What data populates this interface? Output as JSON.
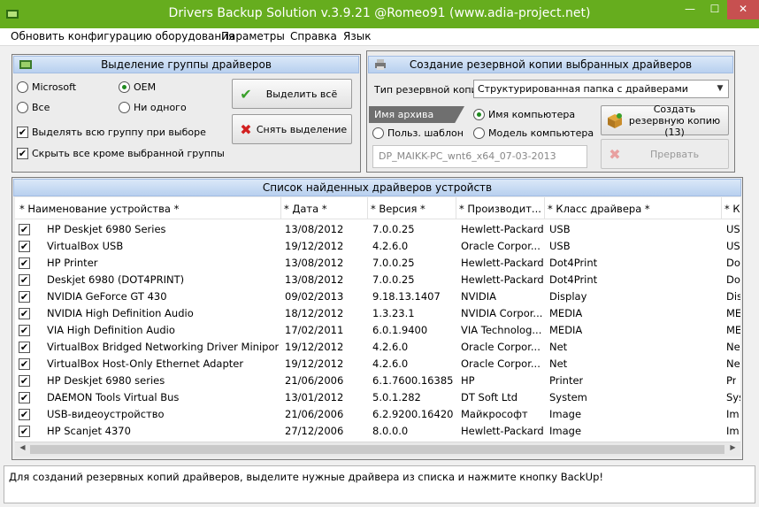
{
  "window": {
    "title": "Drivers Backup Solution v.3.9.21 @Romeo91 (www.adia-project.net)",
    "minimize": "—",
    "maximize": "☐",
    "close": "✕"
  },
  "menu": [
    "Обновить конфигурацию оборудования",
    "Параметры",
    "Справка",
    "Язык"
  ],
  "selection_panel": {
    "title": "Выделение группы драйверов",
    "radios": [
      {
        "label": "Microsoft",
        "checked": false
      },
      {
        "label": "OEM",
        "checked": true
      },
      {
        "label": "Все",
        "checked": false
      },
      {
        "label": "Ни одного",
        "checked": false
      }
    ],
    "checkboxes": [
      {
        "label": "Выделять всю группу при выборе",
        "checked": true
      },
      {
        "label": "Скрыть все кроме выбранной группы",
        "checked": true
      }
    ],
    "select_all_label": "Выделить всё",
    "deselect_label": "Снять выделение"
  },
  "backup_panel": {
    "title": "Создание резервной копии выбранных драйверов",
    "backup_type_label": "Тип резервной копии",
    "backup_type_value": "Структурированная папка с драйверами",
    "archive_name_tab": "Имя архива",
    "radios": [
      {
        "label": "Имя компьютера",
        "checked": true
      },
      {
        "label": "Польз. шаблон",
        "checked": false
      },
      {
        "label": "Модель компьютера",
        "checked": false
      }
    ],
    "archive_name_value": "DP_MAIKK-PC_wnt6_x64_07-03-2013",
    "create_backup_label": "Создать резервную копию (13)",
    "abort_label": "Прервать"
  },
  "drivers_panel": {
    "title": "Список найденных драйверов устройств",
    "columns": [
      "* Наименование устройства *",
      "* Дата *",
      "* Версия *",
      "* Производит...",
      "* Класс драйвера *",
      "* К"
    ],
    "rows": [
      [
        "HP Deskjet 6980 Series",
        "13/08/2012",
        "7.0.0.25",
        "Hewlett-Packard",
        "USB",
        "US"
      ],
      [
        "VirtualBox USB",
        "19/12/2012",
        "4.2.6.0",
        "Oracle Corpor...",
        "USB",
        "US"
      ],
      [
        "HP Printer",
        "13/08/2012",
        "7.0.0.25",
        "Hewlett-Packard",
        "Dot4Print",
        "Do"
      ],
      [
        "Deskjet 6980 (DOT4PRINT)",
        "13/08/2012",
        "7.0.0.25",
        "Hewlett-Packard",
        "Dot4Print",
        "Do"
      ],
      [
        "NVIDIA GeForce GT 430",
        "09/02/2013",
        "9.18.13.1407",
        "NVIDIA",
        "Display",
        "Dis"
      ],
      [
        "NVIDIA High Definition Audio",
        "18/12/2012",
        "1.3.23.1",
        "NVIDIA Corpor...",
        "MEDIA",
        "ME"
      ],
      [
        "VIA High Definition Audio",
        "17/02/2011",
        "6.0.1.9400",
        "VIA Technolog...",
        "MEDIA",
        "ME"
      ],
      [
        "VirtualBox Bridged Networking Driver Miniport",
        "19/12/2012",
        "4.2.6.0",
        "Oracle Corpor...",
        "Net",
        "Ne"
      ],
      [
        "VirtualBox Host-Only Ethernet Adapter",
        "19/12/2012",
        "4.2.6.0",
        "Oracle Corpor...",
        "Net",
        "Ne"
      ],
      [
        "HP Deskjet 6980 series",
        "21/06/2006",
        "6.1.7600.16385",
        "HP",
        "Printer",
        "Pr"
      ],
      [
        "DAEMON Tools Virtual Bus",
        "13/01/2012",
        "5.0.1.282",
        "DT Soft Ltd",
        "System",
        "Sys"
      ],
      [
        "USB-видеоустройство",
        "21/06/2006",
        "6.2.9200.16420",
        "Майкрософт",
        "Image",
        "Im"
      ],
      [
        "HP Scanjet 4370",
        "27/12/2006",
        "8.0.0.0",
        "Hewlett-Packard",
        "Image",
        "Im"
      ]
    ]
  },
  "status": "Для созданий резервных копий драйверов, выделите нужные драйвера из списка и нажмите кнопку BackUp!",
  "colors": {
    "titlebar": "#66ad1e",
    "close": "#c75050",
    "panel_header": "#c9dcf4"
  }
}
